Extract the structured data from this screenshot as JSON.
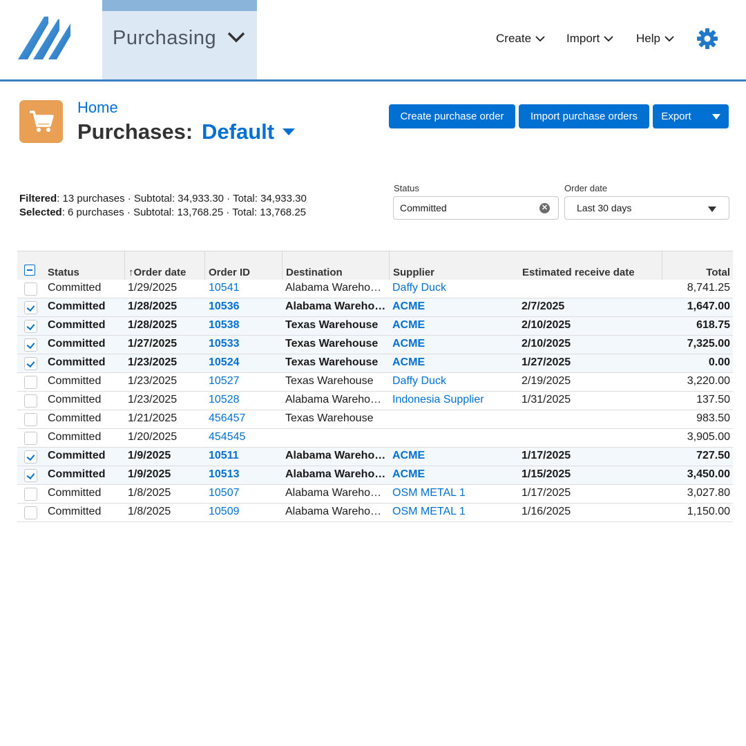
{
  "nav": {
    "module": "Purchasing",
    "create": "Create",
    "import": "Import",
    "help": "Help",
    "icons": [
      "logo-icon",
      "chevron-down-icon",
      "gear-icon"
    ],
    "accent": "#0070d2"
  },
  "header": {
    "breadcrumb": "Home",
    "title": "Purchases:",
    "view": "Default",
    "buttons": {
      "create": "Create purchase order",
      "import": "Import purchase orders",
      "export": "Export"
    },
    "icon": "shopping-cart-icon",
    "icon_color": "#e9a054"
  },
  "summary": {
    "filtered_label": "Filtered",
    "filtered_text": ": 13 purchases · Subtotal: 34,933.30 · Total: 34,933.30",
    "selected_label": "Selected",
    "selected_text": ": 6 purchases · Subtotal: 13,768.25 · Total: 13,768.25"
  },
  "filters": {
    "status_label": "Status",
    "status_value": "Committed",
    "date_label": "Order date",
    "date_value": "Last 30 days"
  },
  "table": {
    "columns": [
      "Status",
      "↑Order date",
      "Order ID",
      "Destination",
      "Supplier",
      "Estimated receive date",
      "Total"
    ],
    "rows": [
      {
        "selected": false,
        "status": "Committed",
        "date": "1/29/2025",
        "id": "10541",
        "destination": "Alabama Wareho…",
        "supplier": "Daffy Duck",
        "receive": "",
        "total": "8,741.25"
      },
      {
        "selected": true,
        "status": "Committed",
        "date": "1/28/2025",
        "id": "10536",
        "destination": "Alabama Wareho…",
        "supplier": "ACME",
        "receive": "2/7/2025",
        "total": "1,647.00"
      },
      {
        "selected": true,
        "status": "Committed",
        "date": "1/28/2025",
        "id": "10538",
        "destination": "Texas Warehouse",
        "supplier": "ACME",
        "receive": "2/10/2025",
        "total": "618.75"
      },
      {
        "selected": true,
        "status": "Committed",
        "date": "1/27/2025",
        "id": "10533",
        "destination": "Texas Warehouse",
        "supplier": "ACME",
        "receive": "2/10/2025",
        "total": "7,325.00"
      },
      {
        "selected": true,
        "status": "Committed",
        "date": "1/23/2025",
        "id": "10524",
        "destination": "Texas Warehouse",
        "supplier": "ACME",
        "receive": "1/27/2025",
        "total": "0.00"
      },
      {
        "selected": false,
        "status": "Committed",
        "date": "1/23/2025",
        "id": "10527",
        "destination": "Texas Warehouse",
        "supplier": "Daffy Duck",
        "receive": "2/19/2025",
        "total": "3,220.00"
      },
      {
        "selected": false,
        "status": "Committed",
        "date": "1/23/2025",
        "id": "10528",
        "destination": "Alabama Wareho…",
        "supplier": "Indonesia Supplier",
        "receive": "1/31/2025",
        "total": "137.50"
      },
      {
        "selected": false,
        "status": "Committed",
        "date": "1/21/2025",
        "id": "456457",
        "destination": "Texas Warehouse",
        "supplier": "",
        "receive": "",
        "total": "983.50"
      },
      {
        "selected": false,
        "status": "Committed",
        "date": "1/20/2025",
        "id": "454545",
        "destination": "",
        "supplier": "",
        "receive": "",
        "total": "3,905.00"
      },
      {
        "selected": true,
        "status": "Committed",
        "date": "1/9/2025",
        "id": "10511",
        "destination": "Alabama Wareho…",
        "supplier": "ACME",
        "receive": "1/17/2025",
        "total": "727.50"
      },
      {
        "selected": true,
        "status": "Committed",
        "date": "1/9/2025",
        "id": "10513",
        "destination": "Alabama Wareho…",
        "supplier": "ACME",
        "receive": "1/15/2025",
        "total": "3,450.00"
      },
      {
        "selected": false,
        "status": "Committed",
        "date": "1/8/2025",
        "id": "10507",
        "destination": "Alabama Wareho…",
        "supplier": "OSM METAL 1",
        "receive": "1/17/2025",
        "total": "3,027.80"
      },
      {
        "selected": false,
        "status": "Committed",
        "date": "1/8/2025",
        "id": "10509",
        "destination": "Alabama Wareho…",
        "supplier": "OSM METAL 1",
        "receive": "1/16/2025",
        "total": "1,150.00"
      }
    ]
  }
}
